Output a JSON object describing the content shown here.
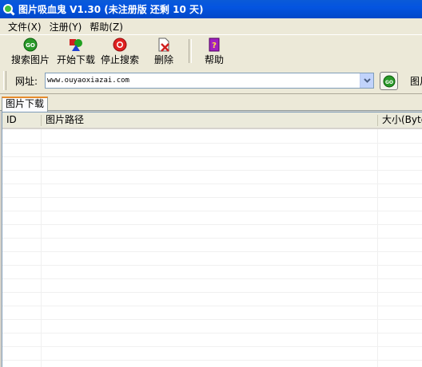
{
  "window": {
    "title": "图片吸血鬼 V1.30 (未注册版 还剩 10 天)"
  },
  "menu": {
    "items": [
      "文件(X)",
      "注册(Y)",
      "帮助(Z)"
    ]
  },
  "toolbar": {
    "search_label": "搜索图片",
    "start_label": "开始下载",
    "stop_label": "停止搜索",
    "delete_label": "删除",
    "help_label": "帮助"
  },
  "address": {
    "label": "网址:",
    "value": "www.ouyaoxiazai.com",
    "go_label": "GO",
    "cut_label": "图片"
  },
  "tabs": [
    {
      "label": "图片下载"
    }
  ],
  "table": {
    "columns": [
      "ID",
      "图片路径",
      "大小(Byte)"
    ],
    "rows": []
  },
  "colors": {
    "title_bar": "#0454e0",
    "tab_accent": "#e68b2c",
    "go_green": "#2a9a2a",
    "stop_red": "#e02020",
    "help_purple": "#a020c0"
  }
}
